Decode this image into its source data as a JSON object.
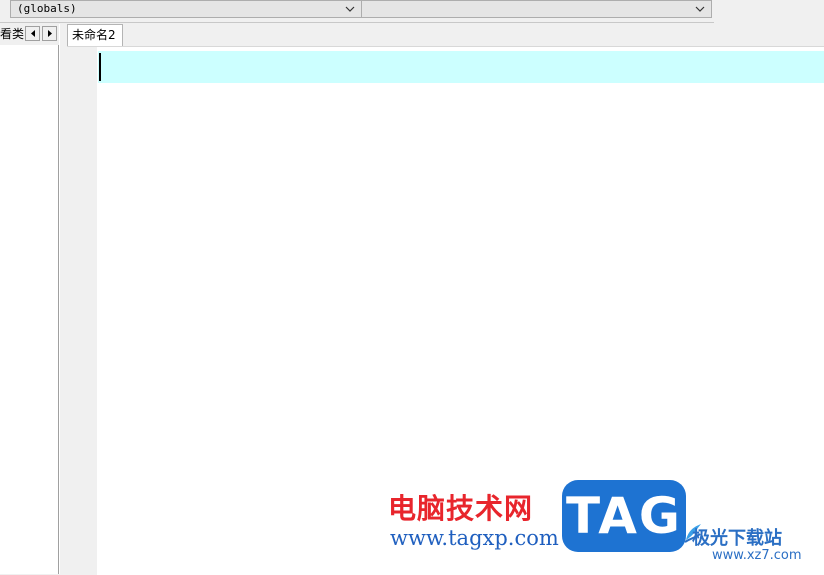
{
  "toolbar": {
    "scope_combo": {
      "value": "(globals)"
    },
    "member_combo": {
      "value": ""
    }
  },
  "left_panel": {
    "tab_label": "看类",
    "scroll_left_icon": "triangle-left-icon",
    "scroll_right_icon": "triangle-right-icon"
  },
  "editor": {
    "tab_label": "未命名2",
    "current_line_color": "#ccffff"
  },
  "watermark": {
    "title": "电脑技术网",
    "url": "www.tagxp.com",
    "logo_text": "TAG",
    "site_name": "极光下载站",
    "site_url": "www.xz7.com",
    "colors": {
      "title": "#e8252c",
      "url": "#1f5fbf",
      "logo": "#1e73d2"
    }
  }
}
